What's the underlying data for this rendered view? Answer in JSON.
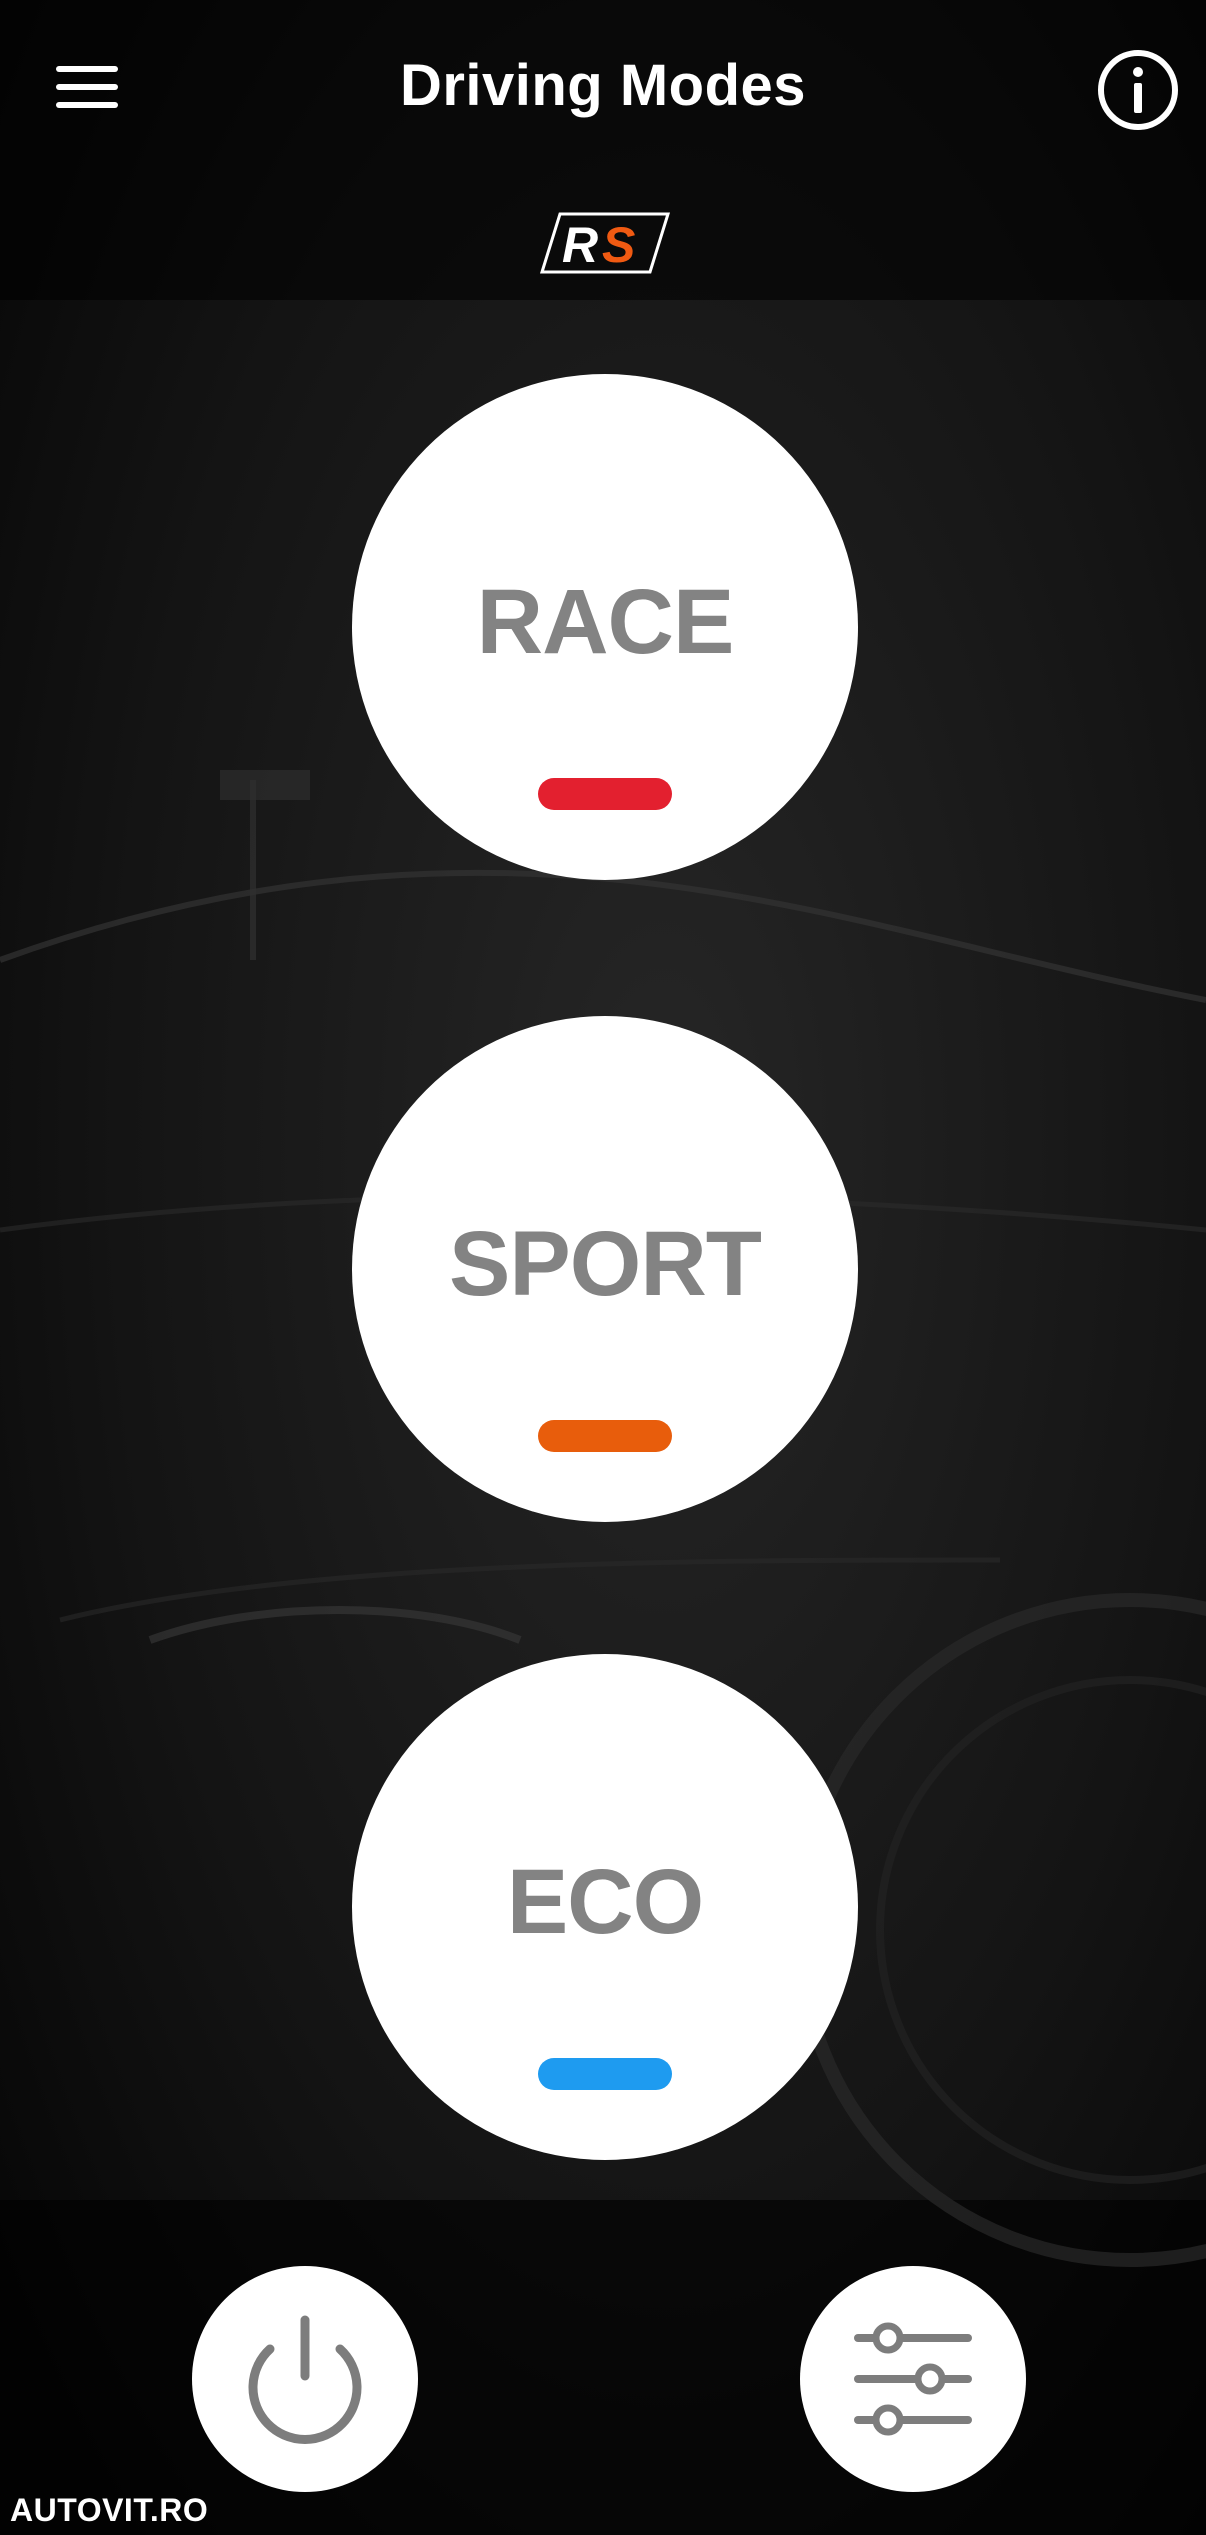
{
  "header": {
    "title": "Driving Modes",
    "menu_icon": "hamburger-menu-icon",
    "info_icon": "info-circle-icon"
  },
  "logo": {
    "text": "RS",
    "colors": {
      "r": "#ffffff",
      "s": "#f05a12"
    }
  },
  "modes": [
    {
      "label": "RACE",
      "color": "#e3202f"
    },
    {
      "label": "SPORT",
      "color": "#e85d0c"
    },
    {
      "label": "ECO",
      "color": "#1e9bf0"
    }
  ],
  "bottom": {
    "power_icon": "power-icon",
    "settings_icon": "sliders-icon"
  },
  "watermark": "AUTOVIT.RO",
  "colors": {
    "background": "#000000",
    "button": "#ffffff",
    "label": "#838383",
    "icon": "#7d7d7d"
  }
}
